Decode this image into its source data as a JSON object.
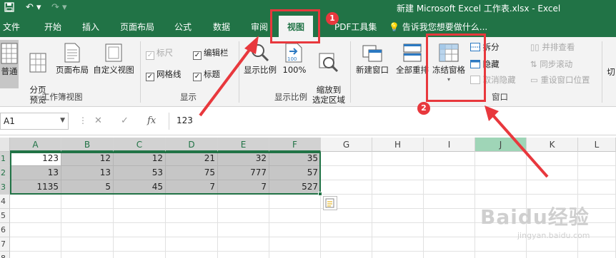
{
  "window": {
    "title": "新建 Microsoft Excel 工作表.xlsx - Excel"
  },
  "tabs": [
    {
      "label": "文件"
    },
    {
      "label": "开始"
    },
    {
      "label": "插入"
    },
    {
      "label": "页面布局"
    },
    {
      "label": "公式"
    },
    {
      "label": "数据"
    },
    {
      "label": "审阅"
    },
    {
      "label": "视图",
      "active": true
    },
    {
      "label": "PDF工具集"
    }
  ],
  "tell_me": "告诉我您想要做什么...",
  "ribbon": {
    "workbook_views": {
      "label": "工作簿视图",
      "buttons": [
        "普通",
        "分页\n预览",
        "页面布局",
        "自定义视图"
      ]
    },
    "show": {
      "label": "显示",
      "checkboxes": [
        {
          "label": "标尺",
          "checked": true,
          "enabled": false
        },
        {
          "label": "编辑栏",
          "checked": true,
          "enabled": true
        },
        {
          "label": "网格线",
          "checked": true,
          "enabled": true
        },
        {
          "label": "标题",
          "checked": true,
          "enabled": true
        }
      ]
    },
    "zoom": {
      "label": "显示比例",
      "buttons": [
        "显示比例",
        "100%",
        "缩放到\n选定区域"
      ]
    },
    "window": {
      "label": "窗口",
      "buttons": [
        "新建窗口",
        "全部重排",
        "冻结窗格"
      ],
      "small": [
        {
          "label": "拆分",
          "enabled": true
        },
        {
          "label": "隐藏",
          "enabled": true
        },
        {
          "label": "取消隐藏",
          "enabled": false
        }
      ],
      "side_by_side": [
        {
          "label": "并排查看",
          "enabled": false
        },
        {
          "label": "同步滚动",
          "enabled": false
        },
        {
          "label": "重设窗口位置",
          "enabled": false
        }
      ],
      "switch": "切"
    }
  },
  "formula_bar": {
    "name_box": "A1",
    "cancel": "✕",
    "enter": "✓",
    "fx": "fx",
    "value": "123"
  },
  "grid": {
    "columns": [
      "A",
      "B",
      "C",
      "D",
      "E",
      "F",
      "G",
      "H",
      "I",
      "J",
      "K",
      "L"
    ],
    "rows": [
      "1",
      "2",
      "3",
      "4",
      "5",
      "6",
      "7",
      "8"
    ],
    "cells": [
      [
        "123",
        "12",
        "12",
        "21",
        "32",
        "35"
      ],
      [
        "13",
        "13",
        "53",
        "75",
        "777",
        "57"
      ],
      [
        "1135",
        "5",
        "45",
        "7",
        "7",
        "527"
      ]
    ],
    "selection": "A1:F3",
    "highlighted_column": "J"
  },
  "annotations": [
    {
      "badge": "1",
      "target": "视图 tab"
    },
    {
      "badge": "2",
      "target": "冻结窗格 button"
    }
  ],
  "watermark": {
    "brand": "Baidu经验",
    "url": "jingyan.baidu.com"
  },
  "colors": {
    "excel_green": "#217346",
    "annotation_red": "#e8383d",
    "selection_gray": "#c6c6c6"
  }
}
